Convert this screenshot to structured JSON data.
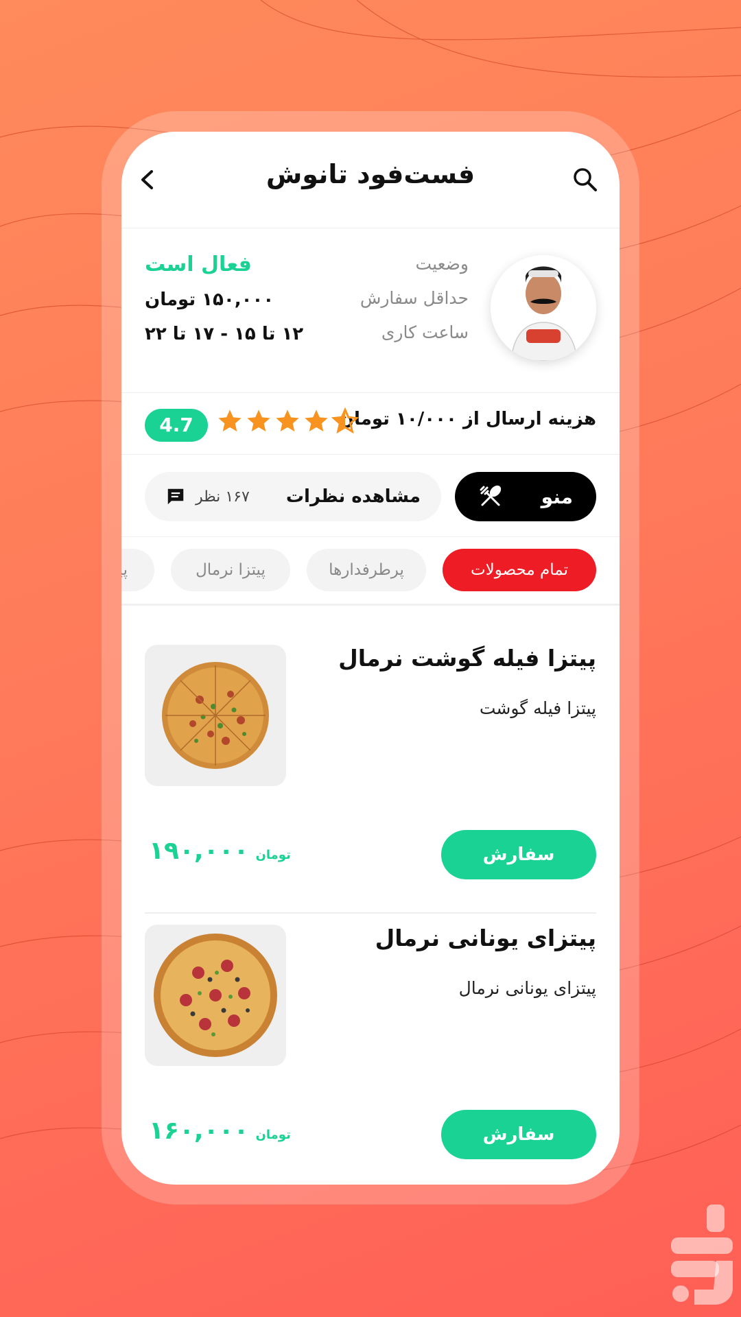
{
  "header": {
    "title": "فست‌فود تانوش"
  },
  "info": {
    "status_label": "وضعیت",
    "status_value": "فعال است",
    "min_order_label": "حداقل سفارش",
    "min_order_value": "۱۵۰,۰۰۰ تومان",
    "hours_label": "ساعت کاری",
    "hours_value": "۱۲ تا ۱۵ - ۱۷ تا ۲۲"
  },
  "delivery": {
    "text": "هزینه ارسال از ۱۰/۰۰۰ تومان",
    "rating": "4.7",
    "stars": 4.5
  },
  "tabs": {
    "menu_label": "منو",
    "reviews_label": "مشاهده نظرات",
    "reviews_count": "۱۶۷ نظر"
  },
  "categories": [
    {
      "label": "تمام محصولات",
      "active": true
    },
    {
      "label": "پرطرفدارها",
      "active": false
    },
    {
      "label": "پیتزا نرمال",
      "active": false
    },
    {
      "label": "پیتز",
      "active": false
    }
  ],
  "products": [
    {
      "name": "پیتزا فیله گوشت نرمال",
      "description": "پیتزا فیله گوشت",
      "order_label": "سفارش",
      "price": "۱۹۰,۰۰۰",
      "currency": "تومان"
    },
    {
      "name": "پیتزای یونانی نرمال",
      "description": "پیتزای یونانی نرمال",
      "order_label": "سفارش",
      "price": "۱۶۰,۰۰۰",
      "currency": "تومان"
    }
  ],
  "colors": {
    "accent": "#19d294",
    "active_chip": "#ee1c25",
    "star": "#f7931e",
    "background_top": "#ff8a5b",
    "background_bottom": "#ff5f56"
  },
  "icons": [
    "search-icon",
    "back-arrow-icon",
    "cutlery-icon",
    "comment-icon",
    "star-icon"
  ]
}
